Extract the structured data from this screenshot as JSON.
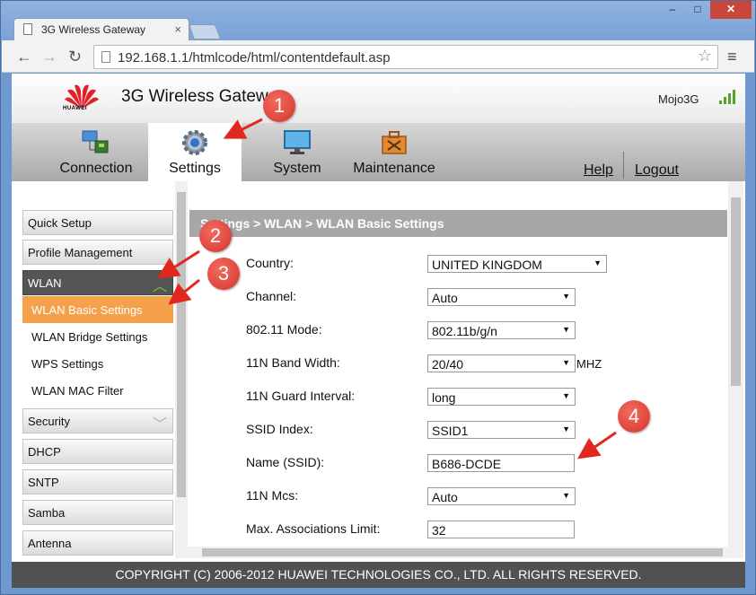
{
  "browser": {
    "tab_title": "3G Wireless Gateway",
    "tab_close": "×",
    "url": "192.168.1.1/htmlcode/html/contentdefault.asp",
    "win_min": "–",
    "win_max": "□",
    "win_close": "✕"
  },
  "header": {
    "logo_text": "HUAWEI",
    "title": "3G Wireless Gateway",
    "user": "Mojo3G"
  },
  "nav": {
    "items": [
      {
        "label": "Connection",
        "icon": "connection-icon"
      },
      {
        "label": "Settings",
        "icon": "gear-icon"
      },
      {
        "label": "System",
        "icon": "monitor-icon"
      },
      {
        "label": "Maintenance",
        "icon": "toolbox-icon"
      }
    ],
    "help": "Help",
    "logout": "Logout"
  },
  "sidebar": {
    "items": [
      "Quick Setup",
      "Profile Management",
      "WLAN"
    ],
    "wlan_sub": [
      "WLAN Basic Settings",
      "WLAN Bridge Settings",
      "WPS Settings",
      "WLAN MAC Filter"
    ],
    "more": [
      "Security",
      "DHCP",
      "SNTP",
      "Samba",
      "Antenna"
    ]
  },
  "content": {
    "breadcrumb": "Settings > WLAN > WLAN Basic Settings",
    "fields": [
      {
        "label": "Country:",
        "value": "UNITED KINGDOM",
        "type": "select"
      },
      {
        "label": "Channel:",
        "value": "Auto",
        "type": "select"
      },
      {
        "label": "802.11 Mode:",
        "value": "802.11b/g/n",
        "type": "select"
      },
      {
        "label": "11N Band Width:",
        "value": "20/40",
        "type": "select",
        "unit": "MHZ"
      },
      {
        "label": "11N Guard Interval:",
        "value": "long",
        "type": "select"
      },
      {
        "label": "SSID Index:",
        "value": "SSID1",
        "type": "select"
      },
      {
        "label": "Name (SSID):",
        "value": "B686-DCDE",
        "type": "input"
      },
      {
        "label": "11N Mcs:",
        "value": "Auto",
        "type": "select"
      },
      {
        "label": "Max. Associations Limit:",
        "value": "32",
        "type": "input"
      }
    ]
  },
  "footer": "COPYRIGHT (C) 2006-2012 HUAWEI TECHNOLOGIES CO., LTD. ALL RIGHTS RESERVED.",
  "markers": [
    "1",
    "2",
    "3",
    "4"
  ],
  "colors": {
    "accent_orange": "#f5a04a",
    "marker_red": "#d6362b",
    "signal_green": "#5aa02c"
  }
}
